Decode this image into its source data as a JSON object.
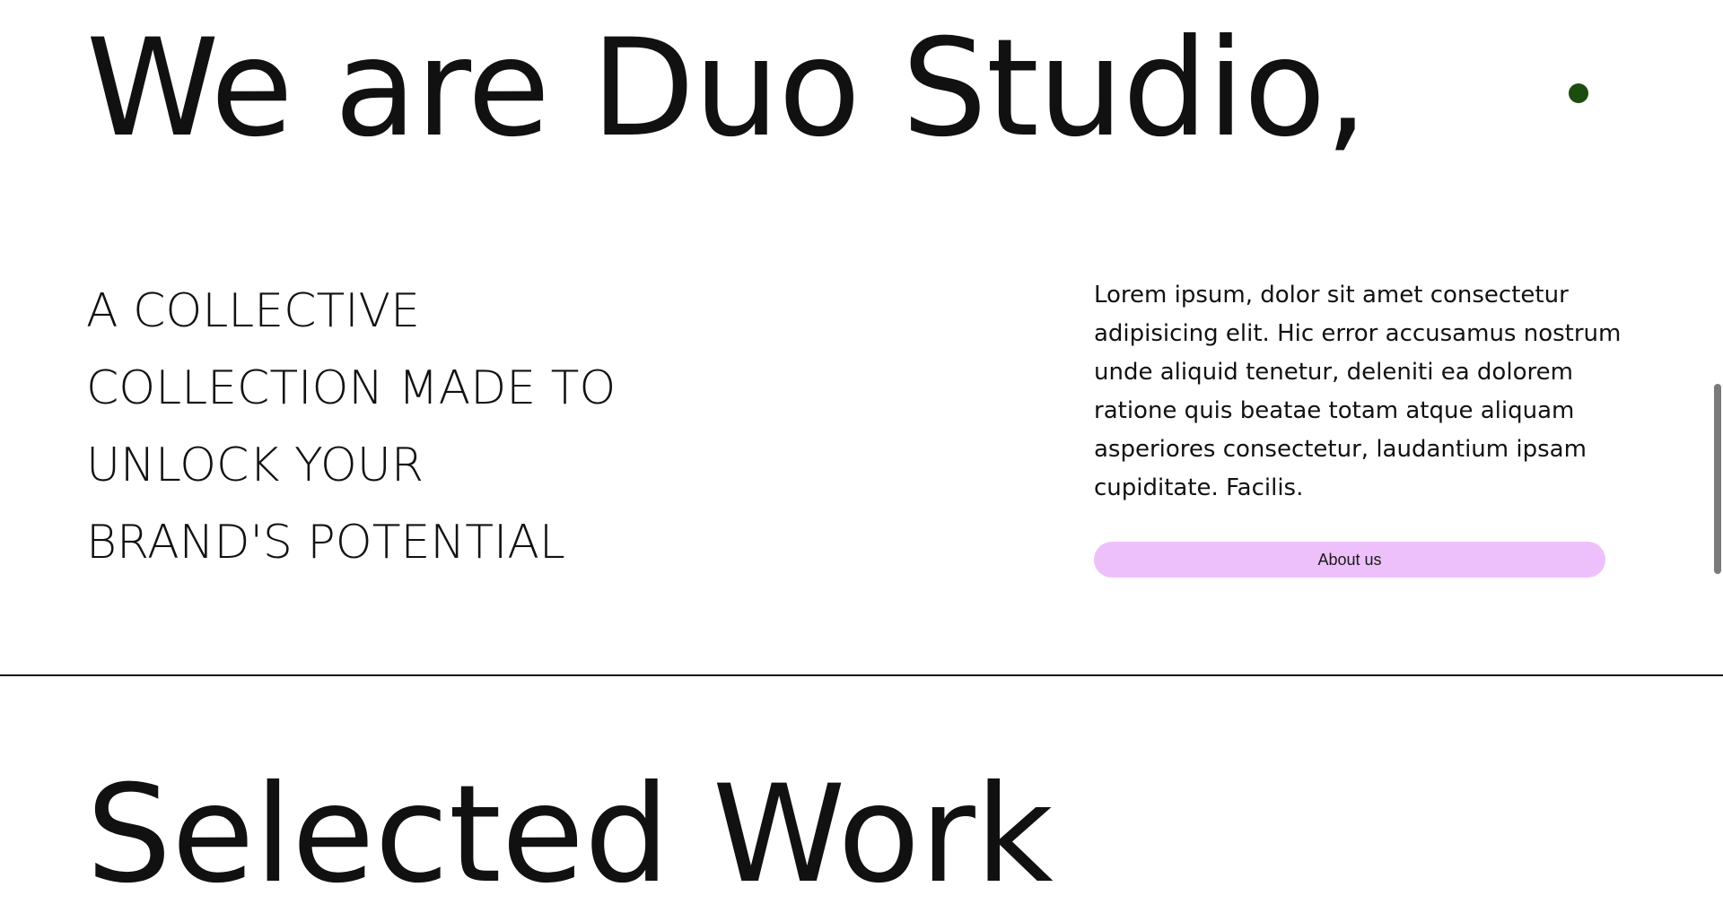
{
  "hero": {
    "title": "We are Duo Studio,"
  },
  "tagline": {
    "lines": [
      "A COLLECTIVE",
      "COLLECTION MADE TO",
      "UNLOCK YOUR",
      "BRAND'S POTENTIAL"
    ]
  },
  "about": {
    "text": "Lorem ipsum, dolor sit amet consectetur adipisicing elit. Hic error accusamus nostrum unde aliquid tenetur, deleniti ea dolorem ratione quis beatae totam atque aliquam asperiores consectetur, laudantium ipsam cupiditate. Facilis.",
    "button_label": "About us"
  },
  "next_section": {
    "title": "Selected Work"
  },
  "colors": {
    "text": "#111111",
    "button_bg": "#EDC0FB",
    "cursor_dot": "#1B4D0E",
    "scrollbar_thumb": "#7A7A7A"
  }
}
